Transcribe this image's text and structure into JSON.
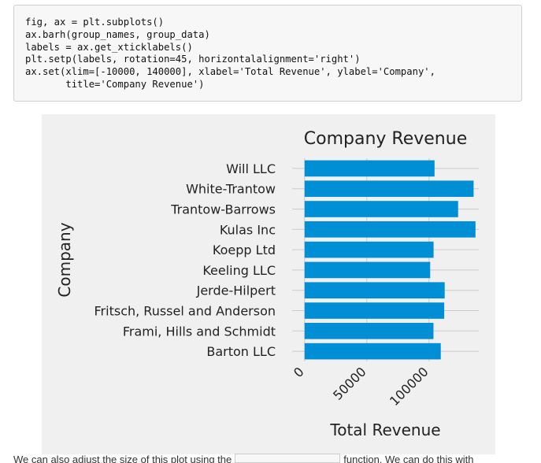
{
  "code_cell": {
    "lines": [
      "fig, ax = plt.subplots()",
      "ax.barh(group_names, group_data)",
      "labels = ax.get_xticklabels()",
      "plt.setp(labels, rotation=45, horizontalalignment='right')",
      "ax.set(xlim=[-10000, 140000], xlabel='Total Revenue', ylabel='Company',",
      "       title='Company Revenue')"
    ]
  },
  "colors": {
    "bar": "#008fd5",
    "figure_bg": "#f0f0f0",
    "grid": "#cbcbcb"
  },
  "chart_data": {
    "type": "bar",
    "orientation": "horizontal",
    "title": "Company Revenue",
    "xlabel": "Total Revenue",
    "ylabel": "Company",
    "xlim": [
      -10000,
      140000
    ],
    "xticks": [
      0,
      50000,
      100000
    ],
    "xtick_labels": [
      "0",
      "50000",
      "100000"
    ],
    "xtick_rotation": 45,
    "grid": true,
    "categories": [
      "Barton LLC",
      "Frami, Hills and Schmidt",
      "Fritsch, Russel and Anderson",
      "Jerde-Hilpert",
      "Keeling LLC",
      "Koepp Ltd",
      "Kulas Inc",
      "Trantow-Barrows",
      "White-Trantow",
      "Will LLC"
    ],
    "values": [
      109438,
      103569,
      112214,
      112591,
      100934,
      103660,
      137351,
      123381,
      135841,
      104437
    ]
  },
  "footer": {
    "text_before": "We can also adjust the size of this plot using the",
    "text_after": "function. We can do this with"
  }
}
